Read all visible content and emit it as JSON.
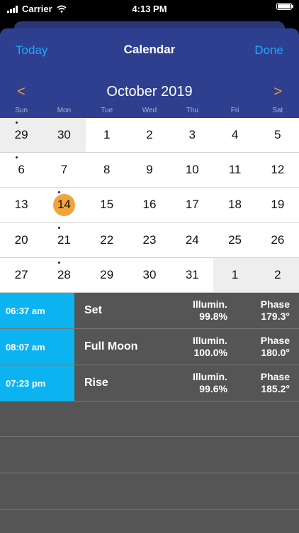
{
  "status_bar": {
    "carrier": "Carrier",
    "time": "4:13 PM"
  },
  "nav": {
    "left_label": "Today",
    "title": "Calendar",
    "right_label": "Done"
  },
  "calendar": {
    "month_title": "October 2019",
    "prev_glyph": "<",
    "next_glyph": ">",
    "weekdays": [
      "Sun",
      "Mon",
      "Tue",
      "Wed",
      "Thu",
      "Fri",
      "Sat"
    ],
    "days": [
      {
        "label": "29",
        "other": true,
        "dot": true
      },
      {
        "label": "30",
        "other": true
      },
      {
        "label": "1"
      },
      {
        "label": "2"
      },
      {
        "label": "3"
      },
      {
        "label": "4"
      },
      {
        "label": "5"
      },
      {
        "label": "6",
        "dot": true
      },
      {
        "label": "7"
      },
      {
        "label": "8"
      },
      {
        "label": "9"
      },
      {
        "label": "10"
      },
      {
        "label": "11"
      },
      {
        "label": "12"
      },
      {
        "label": "13"
      },
      {
        "label": "14",
        "selected": true,
        "dot": true
      },
      {
        "label": "15"
      },
      {
        "label": "16"
      },
      {
        "label": "17"
      },
      {
        "label": "18"
      },
      {
        "label": "19"
      },
      {
        "label": "20"
      },
      {
        "label": "21",
        "dot": true
      },
      {
        "label": "22"
      },
      {
        "label": "23"
      },
      {
        "label": "24"
      },
      {
        "label": "25"
      },
      {
        "label": "26"
      },
      {
        "label": "27"
      },
      {
        "label": "28",
        "dot": true
      },
      {
        "label": "29"
      },
      {
        "label": "30"
      },
      {
        "label": "31"
      },
      {
        "label": "1",
        "other": true
      },
      {
        "label": "2",
        "other": true
      }
    ]
  },
  "events": [
    {
      "time": "06:37 am",
      "name": "Set",
      "illum_label": "Illumin.",
      "illum_value": "99.8%",
      "phase_label": "Phase",
      "phase_value": "179.3°"
    },
    {
      "time": "08:07 am",
      "name": "Full Moon",
      "illum_label": "Illumin.",
      "illum_value": "100.0%",
      "phase_label": "Phase",
      "phase_value": "180.0°"
    },
    {
      "time": "07:23 pm",
      "name": "Rise",
      "illum_label": "Illumin.",
      "illum_value": "99.6%",
      "phase_label": "Phase",
      "phase_value": "185.2°"
    }
  ],
  "colors": {
    "header": "#2f3f8f",
    "accent": "#1ea7ff",
    "selected_day": "#f2a43a",
    "time_cell": "#0bb4f0",
    "chevron": "#e8a040"
  },
  "icons": {
    "wifi": "wifi-icon",
    "battery": "battery-icon",
    "signal": "signal-icon"
  }
}
